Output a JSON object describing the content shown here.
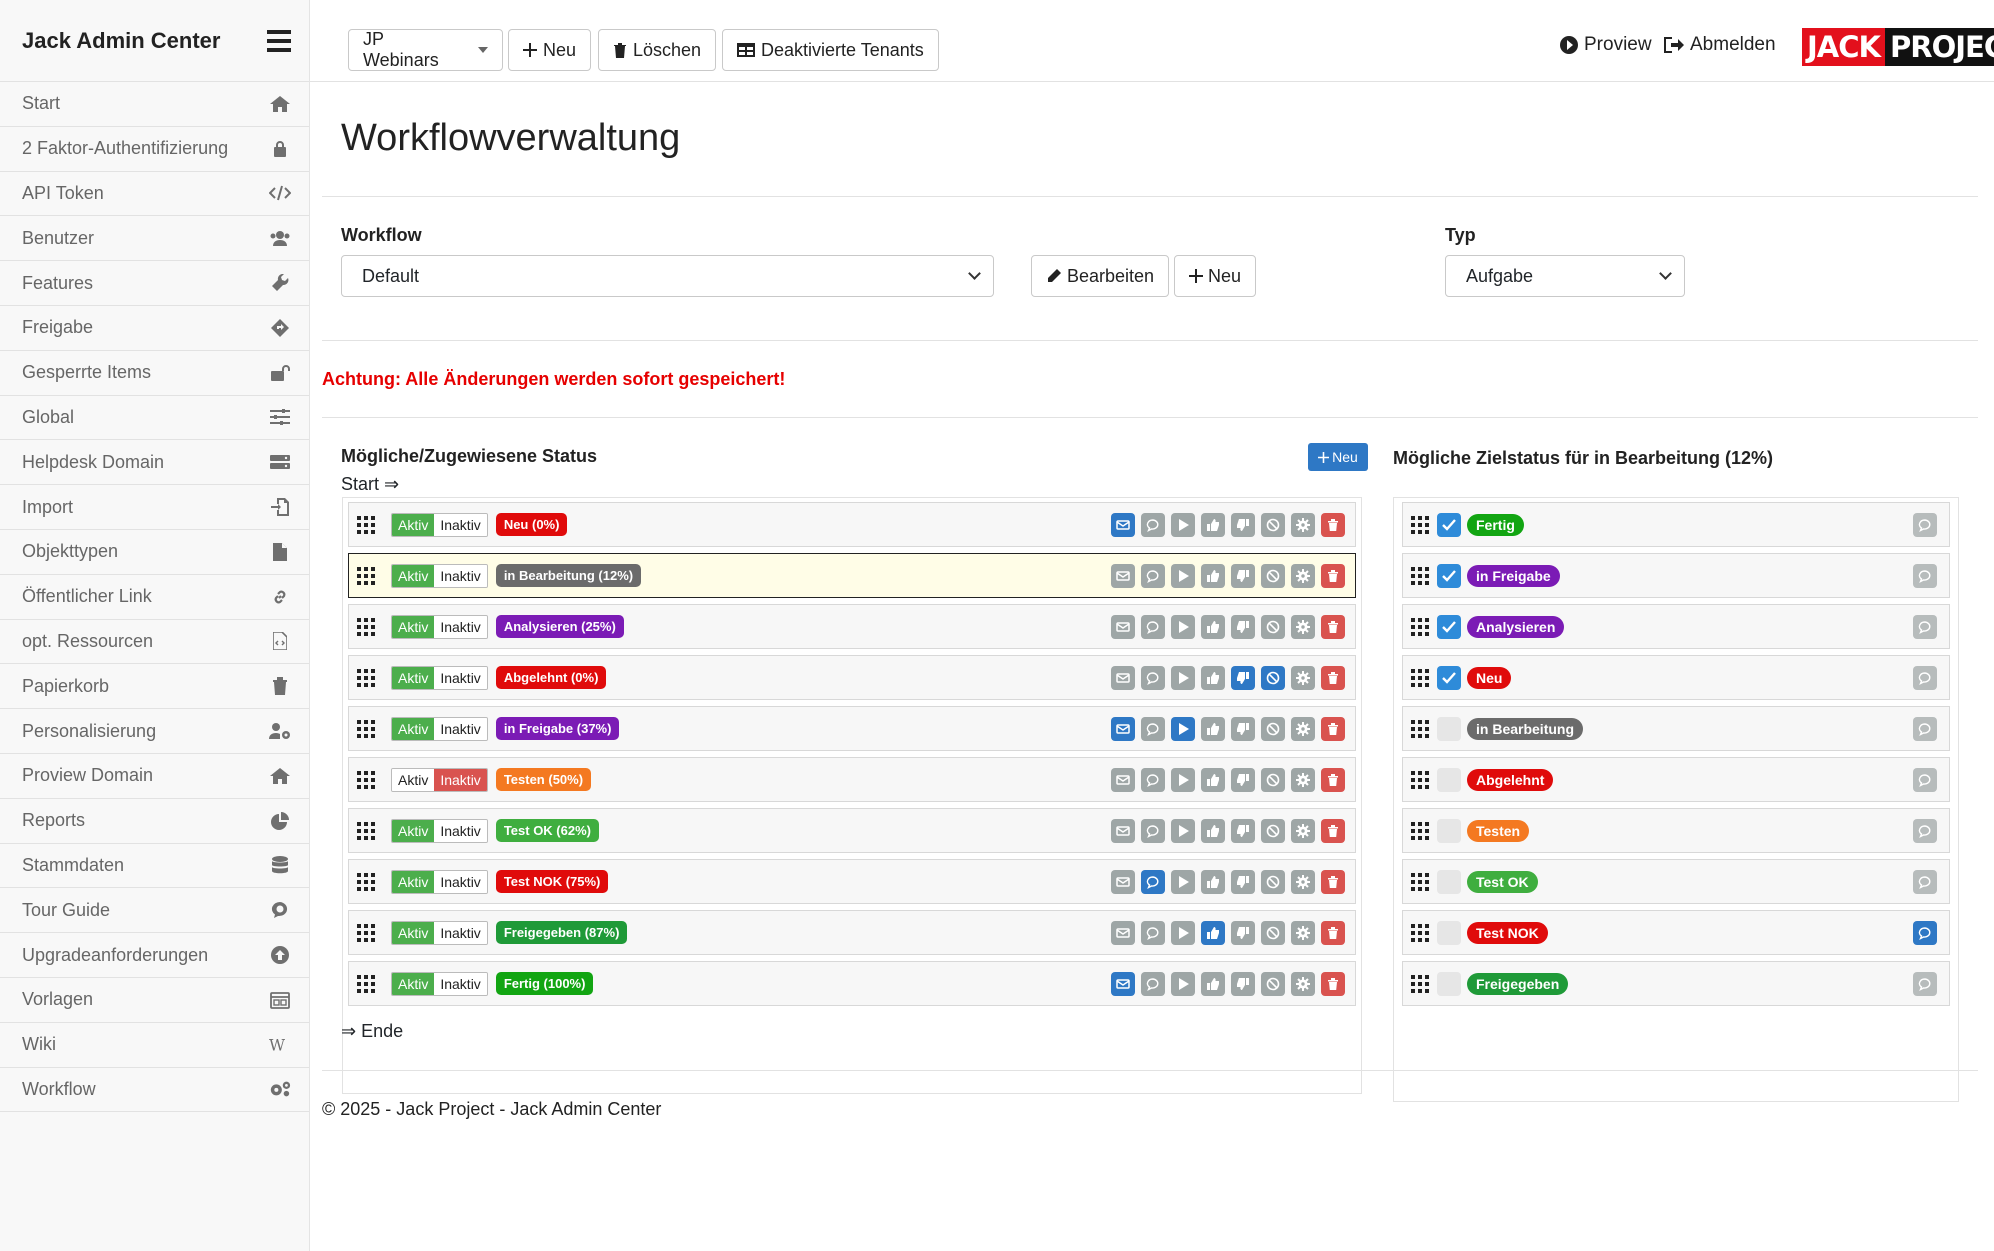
{
  "app_title": "Jack Admin Center",
  "nav": [
    {
      "label": "Start",
      "icon": "home-icon"
    },
    {
      "label": "2 Faktor-Authentifizierung",
      "icon": "lock-icon"
    },
    {
      "label": "API Token",
      "icon": "code-icon"
    },
    {
      "label": "Benutzer",
      "icon": "users-icon"
    },
    {
      "label": "Features",
      "icon": "wrench-icon"
    },
    {
      "label": "Freigabe",
      "icon": "diamond-arrow-icon"
    },
    {
      "label": "Gesperrte Items",
      "icon": "unlock-icon"
    },
    {
      "label": "Global",
      "icon": "sliders-icon"
    },
    {
      "label": "Helpdesk Domain",
      "icon": "server-icon"
    },
    {
      "label": "Import",
      "icon": "file-import-icon"
    },
    {
      "label": "Objekttypen",
      "icon": "file-icon"
    },
    {
      "label": "Öffentlicher Link",
      "icon": "link-icon"
    },
    {
      "label": "opt. Ressourcen",
      "icon": "file-code-icon"
    },
    {
      "label": "Papierkorb",
      "icon": "trash-icon"
    },
    {
      "label": "Personalisierung",
      "icon": "user-gear-icon"
    },
    {
      "label": "Proview Domain",
      "icon": "home-icon"
    },
    {
      "label": "Reports",
      "icon": "pie-chart-icon"
    },
    {
      "label": "Stammdaten",
      "icon": "database-icon"
    },
    {
      "label": "Tour Guide",
      "icon": "comment-icon"
    },
    {
      "label": "Upgradeanforderungen",
      "icon": "arrow-up-circle-icon"
    },
    {
      "label": "Vorlagen",
      "icon": "calendar-icon"
    },
    {
      "label": "Wiki",
      "icon": "wikipedia-icon"
    },
    {
      "label": "Workflow",
      "icon": "gears-icon"
    }
  ],
  "topbar": {
    "tenant": "JP Webinars",
    "new_label": "Neu",
    "delete_label": "Löschen",
    "disabled_tenants_label": "Deaktivierte Tenants",
    "proview_label": "Proview",
    "logout_label": "Abmelden",
    "logo_a": "JACK",
    "logo_b": "PROJECT"
  },
  "page": {
    "title": "Workflowverwaltung",
    "workflow_label": "Workflow",
    "workflow_value": "Default",
    "edit_label": "Bearbeiten",
    "new_label": "Neu",
    "type_label": "Typ",
    "type_value": "Aufgabe",
    "warning": "Achtung: Alle Änderungen werden sofort gespeichert!",
    "status_title": "Mögliche/Zugewiesene Status",
    "status_new_label": "Neu",
    "start_label": "Start ⇒",
    "end_label": "⇒ Ende",
    "target_title": "Mögliche Zielstatus für in Bearbeitung (12%)",
    "footer": "© 2025 - Jack Project - Jack Admin Center"
  },
  "toggle": {
    "on": "Aktiv",
    "off": "Inaktiv"
  },
  "statuses": [
    {
      "label": "Neu (0%)",
      "color": "#e00b0b",
      "active": true,
      "actions": [
        "blue",
        "grey",
        "grey",
        "grey",
        "grey",
        "grey",
        "grey",
        "red"
      ]
    },
    {
      "label": "in Bearbeitung (12%)",
      "color": "#6b6b6b",
      "active": true,
      "selected": true,
      "actions": [
        "grey",
        "grey",
        "grey",
        "grey",
        "grey",
        "grey",
        "grey",
        "red"
      ]
    },
    {
      "label": "Analysieren (25%)",
      "color": "#7b1bb5",
      "active": true,
      "actions": [
        "grey",
        "grey",
        "grey",
        "grey",
        "grey",
        "grey",
        "grey",
        "red"
      ]
    },
    {
      "label": "Abgelehnt (0%)",
      "color": "#e00b0b",
      "active": true,
      "actions": [
        "grey",
        "grey",
        "grey",
        "grey",
        "blue",
        "blue",
        "grey",
        "red"
      ]
    },
    {
      "label": "in Freigabe (37%)",
      "color": "#7b1bb5",
      "active": true,
      "actions": [
        "blue",
        "grey",
        "blue",
        "grey",
        "grey",
        "grey",
        "grey",
        "red"
      ]
    },
    {
      "label": "Testen (50%)",
      "color": "#f47921",
      "active": false,
      "actions": [
        "grey",
        "grey",
        "grey",
        "grey",
        "grey",
        "grey",
        "grey",
        "red"
      ]
    },
    {
      "label": "Test OK (62%)",
      "color": "#3fae3f",
      "active": true,
      "actions": [
        "grey",
        "grey",
        "grey",
        "grey",
        "grey",
        "grey",
        "grey",
        "red"
      ]
    },
    {
      "label": "Test NOK (75%)",
      "color": "#e00b0b",
      "active": true,
      "actions": [
        "grey",
        "blue",
        "grey",
        "grey",
        "grey",
        "grey",
        "grey",
        "red"
      ]
    },
    {
      "label": "Freigegeben (87%)",
      "color": "#1f9a38",
      "active": true,
      "actions": [
        "grey",
        "grey",
        "grey",
        "blue",
        "grey",
        "grey",
        "grey",
        "red"
      ]
    },
    {
      "label": "Fertig (100%)",
      "color": "#12a512",
      "active": true,
      "actions": [
        "blue",
        "grey",
        "grey",
        "grey",
        "grey",
        "grey",
        "grey",
        "red"
      ]
    }
  ],
  "targets": [
    {
      "label": "Fertig",
      "color": "#12a512",
      "checked": true,
      "comment_active": false
    },
    {
      "label": "in Freigabe",
      "color": "#7b1bb5",
      "checked": true,
      "comment_active": false
    },
    {
      "label": "Analysieren",
      "color": "#7b1bb5",
      "checked": true,
      "comment_active": false
    },
    {
      "label": "Neu",
      "color": "#e00b0b",
      "checked": true,
      "comment_active": false
    },
    {
      "label": "in Bearbeitung",
      "color": "#6b6b6b",
      "checked": false,
      "comment_active": false
    },
    {
      "label": "Abgelehnt",
      "color": "#e00b0b",
      "checked": false,
      "comment_active": false
    },
    {
      "label": "Testen",
      "color": "#f47921",
      "checked": false,
      "comment_active": false
    },
    {
      "label": "Test OK",
      "color": "#3fae3f",
      "checked": false,
      "comment_active": false
    },
    {
      "label": "Test NOK",
      "color": "#e00b0b",
      "checked": false,
      "comment_active": true
    },
    {
      "label": "Freigegeben",
      "color": "#1f9a38",
      "checked": false,
      "comment_active": false
    }
  ],
  "action_icons": [
    "envelope-icon",
    "comment-icon",
    "play-icon",
    "thumbs-up-icon",
    "thumbs-down-icon",
    "ban-icon",
    "gear-icon",
    "trash-icon"
  ]
}
